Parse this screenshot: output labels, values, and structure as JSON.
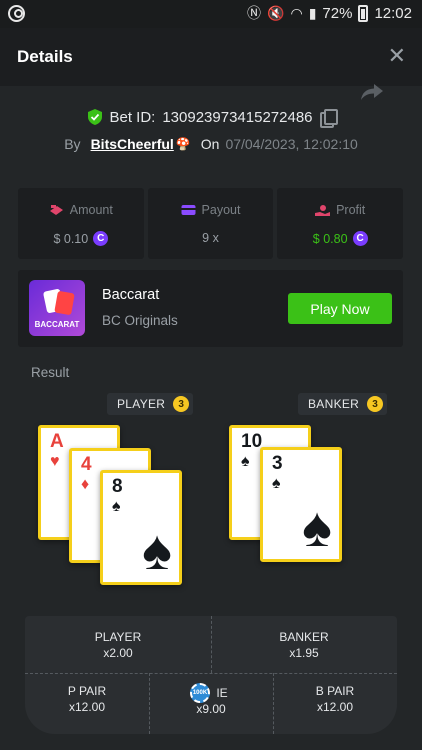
{
  "status_bar": {
    "battery": "72%",
    "time": "12:02"
  },
  "header": {
    "title": "Details",
    "close": "✕"
  },
  "bet": {
    "id_label": "Bet ID:",
    "id": "130923973415272486",
    "by_label": "By",
    "user": "BitsCheerful",
    "on_label": "On",
    "date": "07/04/2023, 12:02:10"
  },
  "stats": {
    "amount": {
      "label": "Amount",
      "value": "$ 0.10"
    },
    "payout": {
      "label": "Payout",
      "value": "9 x"
    },
    "profit": {
      "label": "Profit",
      "value": "$ 0.80"
    }
  },
  "game": {
    "name": "Baccarat",
    "provider": "BC Originals",
    "thumb_text": "BACCARAT",
    "play_label": "Play Now"
  },
  "result": {
    "label": "Result",
    "player": {
      "label": "PLAYER",
      "score": "3",
      "cards": [
        {
          "rank": "A",
          "suit": "♥"
        },
        {
          "rank": "4",
          "suit": "♦"
        },
        {
          "rank": "8",
          "suit": "♠"
        }
      ]
    },
    "banker": {
      "label": "BANKER",
      "score": "3",
      "cards": [
        {
          "rank": "10",
          "suit": "♠"
        },
        {
          "rank": "3",
          "suit": "♠"
        }
      ]
    }
  },
  "bets": {
    "player": {
      "label": "PLAYER",
      "odds": "x2.00"
    },
    "banker": {
      "label": "BANKER",
      "odds": "x1.95"
    },
    "p_pair": {
      "label": "P PAIR",
      "odds": "x12.00"
    },
    "tie": {
      "label": "IE",
      "odds": "x9.00",
      "chip": "100K"
    },
    "b_pair": {
      "label": "B PAIR",
      "odds": "x12.00"
    }
  },
  "colors": {
    "accent_green": "#3bc117",
    "coin_purple": "#7a3cff",
    "card_border": "#f5cf1a",
    "score_yellow": "#f6c722"
  }
}
